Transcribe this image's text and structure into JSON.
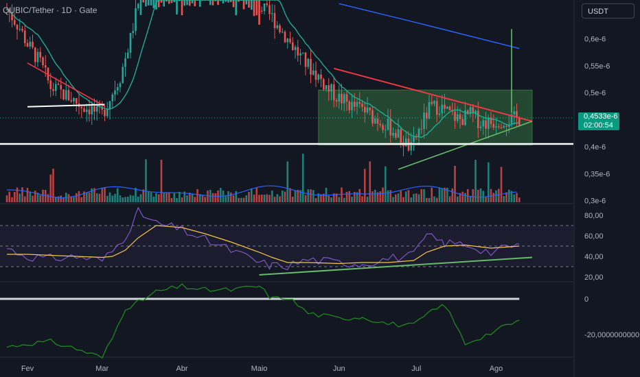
{
  "header": {
    "symbol_title": "QUBIC/Tether · 1D · Gate",
    "currency_button": "USDT"
  },
  "price_tag": {
    "price": "0,4533e-6",
    "countdown": "02:00:54"
  },
  "colors": {
    "background": "#131722",
    "up": "#26a69a",
    "down": "#ef5350",
    "ma": "#22ab94",
    "long_ma": "#2962ff",
    "trend_red": "#f23645",
    "trend_green": "#4caf50",
    "rsi": "#7e57c2",
    "rsi_ma": "#f7c548",
    "support": "#ffffff",
    "box_fill": "#4caf50",
    "osc": "#1e8a1e"
  },
  "chart_data": [
    {
      "type": "candlestick",
      "title": "QUBIC/Tether · 1D · Gate",
      "x_tick_labels": [
        "Fev",
        "Mar",
        "Abr",
        "Maio",
        "Jun",
        "Jul",
        "Ago"
      ],
      "y_tick_labels": [
        "0,6e-6",
        "0,55e-6",
        "0,5e-6",
        "0,4e-6",
        "0,35e-6",
        "0,3e-6"
      ],
      "ylim": [
        2.95e-07,
        6.65e-07
      ],
      "price_path": {
        "dates": [
          "Jan 24",
          "Jan 29",
          "Feb 1",
          "Feb 6",
          "Feb 10",
          "Feb 14",
          "Feb 18",
          "Feb 22",
          "Feb 26",
          "Feb 28",
          "Mar 1",
          "Mar 4",
          "Mar 8",
          "Mar 12",
          "Mar 16",
          "Mar 22",
          "Apr 1",
          "Apr 10",
          "Apr 20",
          "Apr 28",
          "May 1",
          "May 6",
          "May 12",
          "May 18",
          "May 24",
          "May 28",
          "Jun 1",
          "Jun 6",
          "Jun 10",
          "Jun 14",
          "Jun 18",
          "Jun 22",
          "Jun 26",
          "Jun 29",
          "Jul 2",
          "Jul 6",
          "Jul 10",
          "Jul 14",
          "Jul 18",
          "Jul 22",
          "Jul 26",
          "Jul 30",
          "Aug 3",
          "Aug 7",
          "Aug 10"
        ],
        "values": [
          0.655,
          0.62,
          0.59,
          0.555,
          0.51,
          0.5,
          0.49,
          0.475,
          0.47,
          0.46,
          0.46,
          0.49,
          0.53,
          0.6,
          0.69,
          0.74,
          0.75,
          0.75,
          0.75,
          0.75,
          0.66,
          0.64,
          0.6,
          0.56,
          0.53,
          0.505,
          0.49,
          0.475,
          0.47,
          0.455,
          0.445,
          0.43,
          0.41,
          0.395,
          0.43,
          0.47,
          0.475,
          0.46,
          0.45,
          0.46,
          0.445,
          0.445,
          0.45,
          0.45,
          0.4533
        ]
      },
      "last_price": 4.533e-07,
      "annotations": {
        "horizontal_support": 4.05e-07,
        "range_box": {
          "from": "May 24",
          "to": "Aug 15",
          "top": 5.05e-07,
          "bottom": 4.03e-07
        },
        "descending_trendline_red": [
          {
            "date": "May 30",
            "value": 5.45e-07
          },
          {
            "date": "Aug 15",
            "value": 4.47e-07
          }
        ],
        "descending_trendline_red_feb": [
          {
            "date": "Feb 1",
            "value": 5.55e-07
          },
          {
            "date": "Mar 2",
            "value": 4.75e-07
          }
        ],
        "feb_support_white": [
          {
            "date": "Feb 1",
            "value": 4.74e-07
          },
          {
            "date": "Mar 2",
            "value": 4.78e-07
          }
        ],
        "ascending_trendline_green": [
          {
            "date": "Jun 24",
            "value": 3.58e-07
          },
          {
            "date": "Aug 15",
            "value": 4.47e-07
          }
        ],
        "projection_line": [
          {
            "date": "Aug 7",
            "value": 4.63e-07
          },
          {
            "date": "Aug 7",
            "value": 6.18e-07
          }
        ],
        "moving_average_200": [
          {
            "date": "Jun 1",
            "value": 6.65e-07
          },
          {
            "date": "Jul 1",
            "value": 6.3e-07
          },
          {
            "date": "Aug 10",
            "value": 5.82e-07
          }
        ]
      }
    },
    {
      "type": "bar",
      "name": "volume",
      "series_names": [
        "volume",
        "volume MA"
      ]
    },
    {
      "type": "line",
      "name": "RSI",
      "y_tick_labels": [
        "80,00",
        "60,00",
        "40,00",
        "20,00"
      ],
      "ylim": [
        17,
        86
      ],
      "bands": [
        70,
        50,
        30
      ],
      "x": [
        "Jan 24",
        "Feb 1",
        "Feb 10",
        "Feb 20",
        "Mar 1",
        "Mar 5",
        "Mar 10",
        "Mar 15",
        "Mar 22",
        "Apr 1",
        "Apr 10",
        "Apr 20",
        "May 1",
        "May 6",
        "May 12",
        "May 20",
        "Jun 1",
        "Jun 10",
        "Jun 20",
        "Jun 30",
        "Jul 5",
        "Jul 12",
        "Jul 20",
        "Jul 30",
        "Aug 10"
      ],
      "rsi": [
        48,
        40,
        38,
        40,
        36,
        45,
        60,
        83,
        72,
        66,
        56,
        46,
        34,
        31,
        31,
        37,
        34,
        33,
        38,
        41,
        60,
        53,
        52,
        44,
        52
      ],
      "rsi_ma": [
        42,
        42,
        41,
        40,
        39,
        40,
        46,
        58,
        70,
        68,
        62,
        54,
        44,
        39,
        34,
        34,
        33,
        34,
        34,
        36,
        44,
        50,
        51,
        48,
        50
      ],
      "trendline": [
        {
          "date": "May 1",
          "value": 22
        },
        {
          "date": "Aug 15",
          "value": 39
        }
      ]
    },
    {
      "type": "line",
      "name": "oscillator",
      "y_tick_labels": [
        "0",
        "-20,0000000000"
      ],
      "x": [
        "Jan 24",
        "Feb 1",
        "Feb 10",
        "Feb 20",
        "Mar 1",
        "Mar 5",
        "Mar 10",
        "Mar 15",
        "Mar 22",
        "Apr 1",
        "Apr 10",
        "Apr 20",
        "May 1",
        "May 6",
        "May 12",
        "May 20",
        "Jun 1",
        "Jun 10",
        "Jun 20",
        "Jun 30",
        "Jul 5",
        "Jul 12",
        "Jul 20",
        "Jul 30",
        "Aug 10"
      ],
      "values": [
        -27,
        -25,
        -24,
        -28,
        -33,
        -22,
        -5,
        -2,
        4,
        7,
        5,
        5,
        7,
        0,
        1,
        -8,
        -11,
        -10,
        -14,
        -15,
        -9,
        -3,
        -25,
        -19,
        -12
      ],
      "zero_line": 0
    }
  ]
}
